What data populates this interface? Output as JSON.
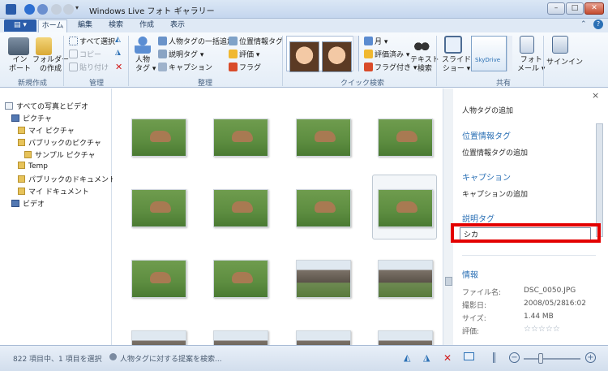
{
  "window": {
    "title": "Windows Live フォト ギャラリー",
    "minimize": "–",
    "maximize": "□",
    "close": "✕"
  },
  "tabs": {
    "file_menu": "▤ ▾",
    "home": "ホーム",
    "edit": "編集",
    "find": "検索",
    "create": "作成",
    "view": "表示"
  },
  "ribbon": {
    "new": {
      "import": "イン\nポート",
      "folder": "フォルダー\nの作成",
      "label": "新規作成"
    },
    "manage": {
      "select_all": "すべて選択",
      "copy": "コピー",
      "paste": "貼り付け",
      "label": "管理"
    },
    "organize": {
      "people_tag": "人物\nタグ ▾",
      "batch_people": "人物タグの一括追加",
      "geotag": "位置情報タグ",
      "descriptive": "説明タグ ▾",
      "rating": "評価 ▾",
      "caption": "キャプション",
      "flag": "フラグ",
      "label": "整理"
    },
    "quickfind": {
      "month": "月 ▾",
      "rated": "評価済み ▾",
      "flagged": "フラグ付き ▾",
      "text_search": "テキスト\n検索",
      "label": "クイック検索"
    },
    "share": {
      "slideshow": "スライド\nショー ▾",
      "skydrive": "SkyDrive",
      "photo_mail": "フォト\nメール ▾",
      "label": "共有"
    },
    "account": {
      "signin": "サインイン"
    }
  },
  "nav": {
    "items": [
      {
        "label": "すべての写真とビデオ"
      },
      {
        "label": "ピクチャ"
      },
      {
        "label": "マイ ピクチャ"
      },
      {
        "label": "パブリックのピクチャ"
      },
      {
        "label": "サンプル ピクチャ"
      },
      {
        "label": "Temp"
      },
      {
        "label": "パブリックのドキュメント"
      },
      {
        "label": "マイ ドキュメント"
      },
      {
        "label": "ビデオ"
      }
    ]
  },
  "pane": {
    "close": "×",
    "people_tag_add": "人物タグの追加",
    "geotag_head": "位置情報タグ",
    "geotag_add": "位置情報タグの追加",
    "caption_head": "キャプション",
    "caption_add": "キャプションの追加",
    "desc_head": "説明タグ",
    "desc_value": "シカ",
    "info_head": "情報",
    "info": {
      "filename_label": "ファイル名:",
      "filename": "DSC_0050.JPG",
      "date_label": "撮影日:",
      "date": "2008/05/28",
      "time": "16:02",
      "size_label": "サイズ:",
      "size": "1.44 MB",
      "rating_label": "評価:",
      "rating_stars": "☆☆☆☆☆"
    }
  },
  "status": {
    "count": "822 項目中、1 項目を選択",
    "suggest": "人物タグに対する提案を検索..."
  },
  "colors": {
    "accent": "#2b70b5",
    "highlight": "#e30000"
  }
}
